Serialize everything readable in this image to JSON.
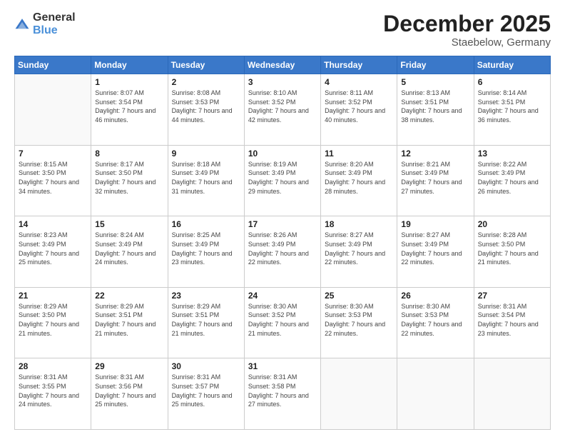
{
  "header": {
    "logo_general": "General",
    "logo_blue": "Blue",
    "title": "December 2025",
    "subtitle": "Staebelow, Germany"
  },
  "columns": [
    "Sunday",
    "Monday",
    "Tuesday",
    "Wednesday",
    "Thursday",
    "Friday",
    "Saturday"
  ],
  "weeks": [
    [
      {
        "day": "",
        "sunrise": "",
        "sunset": "",
        "daylight": ""
      },
      {
        "day": "1",
        "sunrise": "Sunrise: 8:07 AM",
        "sunset": "Sunset: 3:54 PM",
        "daylight": "Daylight: 7 hours and 46 minutes."
      },
      {
        "day": "2",
        "sunrise": "Sunrise: 8:08 AM",
        "sunset": "Sunset: 3:53 PM",
        "daylight": "Daylight: 7 hours and 44 minutes."
      },
      {
        "day": "3",
        "sunrise": "Sunrise: 8:10 AM",
        "sunset": "Sunset: 3:52 PM",
        "daylight": "Daylight: 7 hours and 42 minutes."
      },
      {
        "day": "4",
        "sunrise": "Sunrise: 8:11 AM",
        "sunset": "Sunset: 3:52 PM",
        "daylight": "Daylight: 7 hours and 40 minutes."
      },
      {
        "day": "5",
        "sunrise": "Sunrise: 8:13 AM",
        "sunset": "Sunset: 3:51 PM",
        "daylight": "Daylight: 7 hours and 38 minutes."
      },
      {
        "day": "6",
        "sunrise": "Sunrise: 8:14 AM",
        "sunset": "Sunset: 3:51 PM",
        "daylight": "Daylight: 7 hours and 36 minutes."
      }
    ],
    [
      {
        "day": "7",
        "sunrise": "Sunrise: 8:15 AM",
        "sunset": "Sunset: 3:50 PM",
        "daylight": "Daylight: 7 hours and 34 minutes."
      },
      {
        "day": "8",
        "sunrise": "Sunrise: 8:17 AM",
        "sunset": "Sunset: 3:50 PM",
        "daylight": "Daylight: 7 hours and 32 minutes."
      },
      {
        "day": "9",
        "sunrise": "Sunrise: 8:18 AM",
        "sunset": "Sunset: 3:49 PM",
        "daylight": "Daylight: 7 hours and 31 minutes."
      },
      {
        "day": "10",
        "sunrise": "Sunrise: 8:19 AM",
        "sunset": "Sunset: 3:49 PM",
        "daylight": "Daylight: 7 hours and 29 minutes."
      },
      {
        "day": "11",
        "sunrise": "Sunrise: 8:20 AM",
        "sunset": "Sunset: 3:49 PM",
        "daylight": "Daylight: 7 hours and 28 minutes."
      },
      {
        "day": "12",
        "sunrise": "Sunrise: 8:21 AM",
        "sunset": "Sunset: 3:49 PM",
        "daylight": "Daylight: 7 hours and 27 minutes."
      },
      {
        "day": "13",
        "sunrise": "Sunrise: 8:22 AM",
        "sunset": "Sunset: 3:49 PM",
        "daylight": "Daylight: 7 hours and 26 minutes."
      }
    ],
    [
      {
        "day": "14",
        "sunrise": "Sunrise: 8:23 AM",
        "sunset": "Sunset: 3:49 PM",
        "daylight": "Daylight: 7 hours and 25 minutes."
      },
      {
        "day": "15",
        "sunrise": "Sunrise: 8:24 AM",
        "sunset": "Sunset: 3:49 PM",
        "daylight": "Daylight: 7 hours and 24 minutes."
      },
      {
        "day": "16",
        "sunrise": "Sunrise: 8:25 AM",
        "sunset": "Sunset: 3:49 PM",
        "daylight": "Daylight: 7 hours and 23 minutes."
      },
      {
        "day": "17",
        "sunrise": "Sunrise: 8:26 AM",
        "sunset": "Sunset: 3:49 PM",
        "daylight": "Daylight: 7 hours and 22 minutes."
      },
      {
        "day": "18",
        "sunrise": "Sunrise: 8:27 AM",
        "sunset": "Sunset: 3:49 PM",
        "daylight": "Daylight: 7 hours and 22 minutes."
      },
      {
        "day": "19",
        "sunrise": "Sunrise: 8:27 AM",
        "sunset": "Sunset: 3:49 PM",
        "daylight": "Daylight: 7 hours and 22 minutes."
      },
      {
        "day": "20",
        "sunrise": "Sunrise: 8:28 AM",
        "sunset": "Sunset: 3:50 PM",
        "daylight": "Daylight: 7 hours and 21 minutes."
      }
    ],
    [
      {
        "day": "21",
        "sunrise": "Sunrise: 8:29 AM",
        "sunset": "Sunset: 3:50 PM",
        "daylight": "Daylight: 7 hours and 21 minutes."
      },
      {
        "day": "22",
        "sunrise": "Sunrise: 8:29 AM",
        "sunset": "Sunset: 3:51 PM",
        "daylight": "Daylight: 7 hours and 21 minutes."
      },
      {
        "day": "23",
        "sunrise": "Sunrise: 8:29 AM",
        "sunset": "Sunset: 3:51 PM",
        "daylight": "Daylight: 7 hours and 21 minutes."
      },
      {
        "day": "24",
        "sunrise": "Sunrise: 8:30 AM",
        "sunset": "Sunset: 3:52 PM",
        "daylight": "Daylight: 7 hours and 21 minutes."
      },
      {
        "day": "25",
        "sunrise": "Sunrise: 8:30 AM",
        "sunset": "Sunset: 3:53 PM",
        "daylight": "Daylight: 7 hours and 22 minutes."
      },
      {
        "day": "26",
        "sunrise": "Sunrise: 8:30 AM",
        "sunset": "Sunset: 3:53 PM",
        "daylight": "Daylight: 7 hours and 22 minutes."
      },
      {
        "day": "27",
        "sunrise": "Sunrise: 8:31 AM",
        "sunset": "Sunset: 3:54 PM",
        "daylight": "Daylight: 7 hours and 23 minutes."
      }
    ],
    [
      {
        "day": "28",
        "sunrise": "Sunrise: 8:31 AM",
        "sunset": "Sunset: 3:55 PM",
        "daylight": "Daylight: 7 hours and 24 minutes."
      },
      {
        "day": "29",
        "sunrise": "Sunrise: 8:31 AM",
        "sunset": "Sunset: 3:56 PM",
        "daylight": "Daylight: 7 hours and 25 minutes."
      },
      {
        "day": "30",
        "sunrise": "Sunrise: 8:31 AM",
        "sunset": "Sunset: 3:57 PM",
        "daylight": "Daylight: 7 hours and 25 minutes."
      },
      {
        "day": "31",
        "sunrise": "Sunrise: 8:31 AM",
        "sunset": "Sunset: 3:58 PM",
        "daylight": "Daylight: 7 hours and 27 minutes."
      },
      {
        "day": "",
        "sunrise": "",
        "sunset": "",
        "daylight": ""
      },
      {
        "day": "",
        "sunrise": "",
        "sunset": "",
        "daylight": ""
      },
      {
        "day": "",
        "sunrise": "",
        "sunset": "",
        "daylight": ""
      }
    ]
  ]
}
